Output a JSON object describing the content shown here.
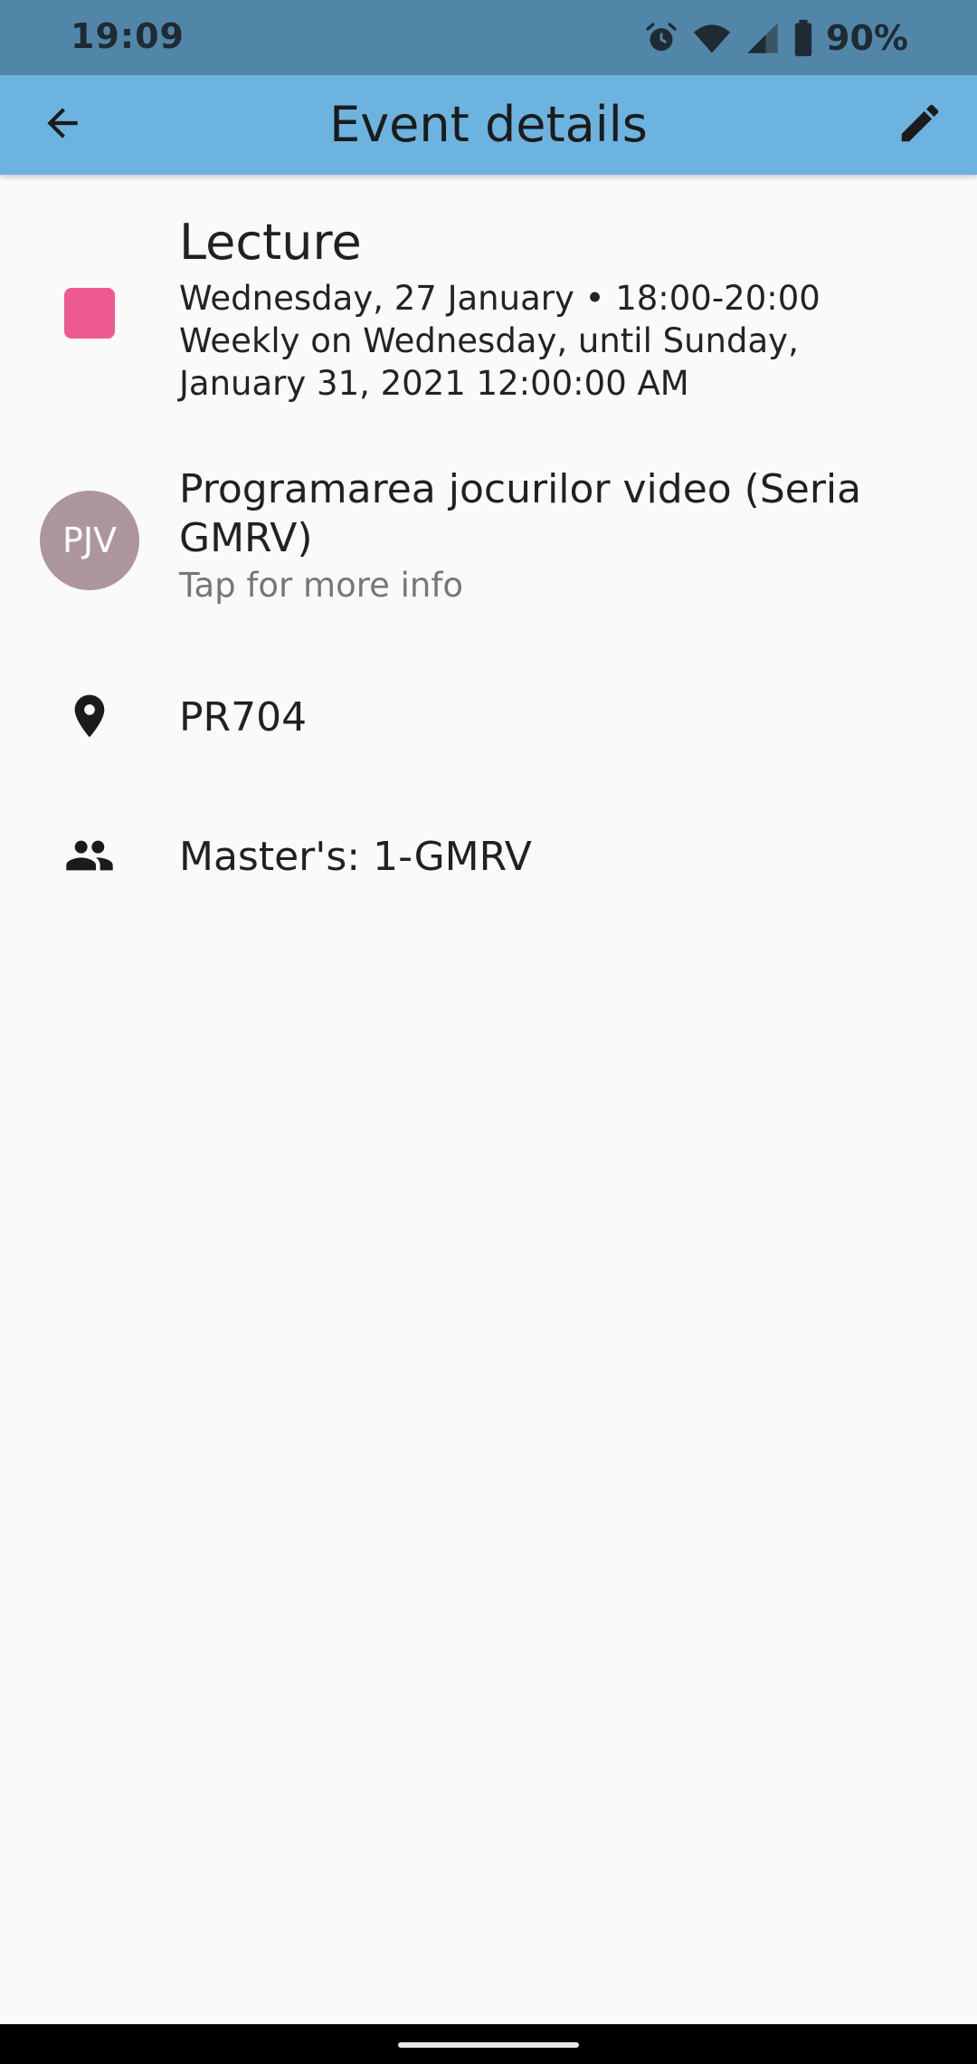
{
  "status_bar": {
    "time": "19:09",
    "battery": "90%",
    "icons": [
      "alarm-icon",
      "wifi-icon",
      "signal-icon",
      "battery-icon"
    ]
  },
  "app_bar": {
    "title": "Event details",
    "back_icon": "arrow-back-icon",
    "edit_icon": "edit-pencil-icon"
  },
  "event": {
    "title": "Lecture",
    "color": "#ee5990",
    "time": "Wednesday, 27 January • 18:00-20:00",
    "recurrence": "Weekly on Wednesday, until Sunday, January 31, 2021 12:00:00 AM"
  },
  "course": {
    "avatar_initials": "PJV",
    "avatar_color": "#ad959f",
    "name": "Programarea jocurilor video (Seria GMRV)",
    "hint": "Tap for more info"
  },
  "location": {
    "icon": "location-pin-icon",
    "value": "PR704"
  },
  "group": {
    "icon": "people-icon",
    "value": "Master's: 1-GMRV"
  },
  "colors": {
    "status_bar": "#5186a9",
    "app_bar": "#6db3df",
    "background": "#fafafa"
  }
}
